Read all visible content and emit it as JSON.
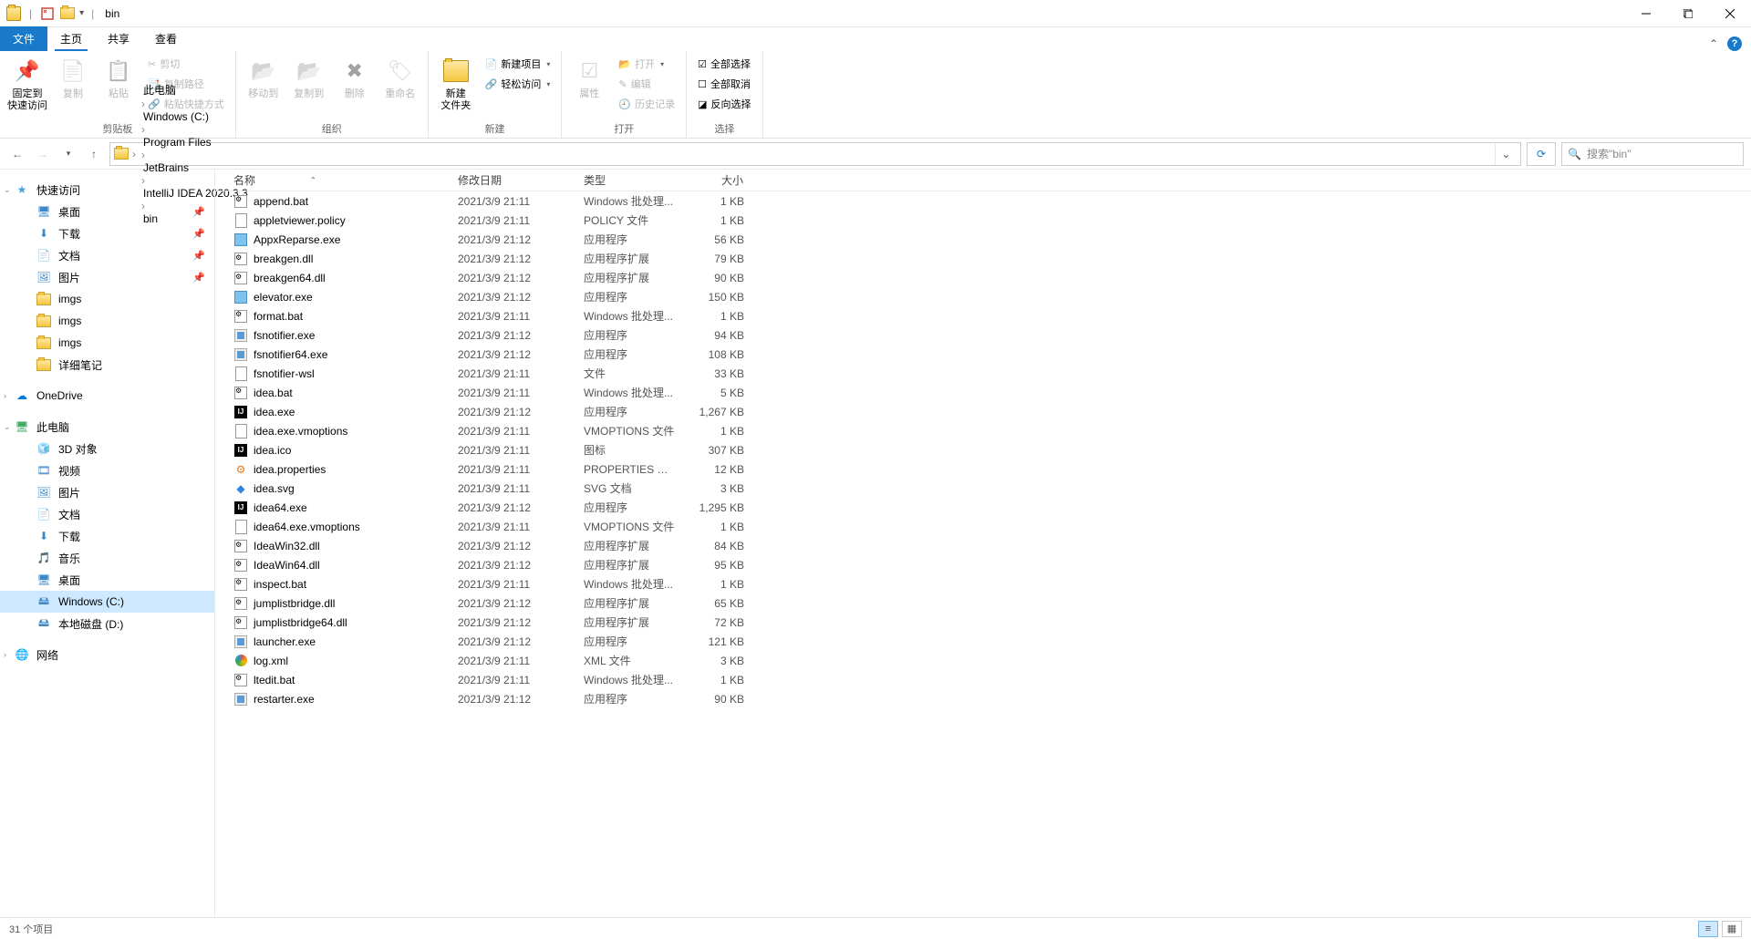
{
  "title": "bin",
  "tabs": {
    "file": "文件",
    "home": "主页",
    "share": "共享",
    "view": "查看"
  },
  "ribbon": {
    "groups": {
      "clipboard": {
        "label": "剪贴板",
        "pin": "固定到\n快速访问",
        "copy": "复制",
        "paste": "粘贴",
        "cut": "剪切",
        "copypath": "复制路径",
        "pasteshortcut": "粘贴快捷方式"
      },
      "organize": {
        "label": "组织",
        "moveto": "移动到",
        "copyto": "复制到",
        "delete": "删除",
        "rename": "重命名"
      },
      "new": {
        "label": "新建",
        "newfolder": "新建\n文件夹",
        "newitem": "新建项目",
        "easyaccess": "轻松访问"
      },
      "open": {
        "label": "打开",
        "properties": "属性",
        "open": "打开",
        "edit": "编辑",
        "history": "历史记录"
      },
      "select": {
        "label": "选择",
        "selectall": "全部选择",
        "selectnone": "全部取消",
        "invert": "反向选择"
      }
    }
  },
  "breadcrumbs": [
    "此电脑",
    "Windows (C:)",
    "Program Files",
    "JetBrains",
    "IntelliJ IDEA 2020.3.3",
    "bin"
  ],
  "search": {
    "placeholder": "搜索\"bin\""
  },
  "sidebar": {
    "quickaccess": "快速访问",
    "qa_items": [
      {
        "label": "桌面",
        "icon": "desktop",
        "pinned": true
      },
      {
        "label": "下载",
        "icon": "downloads",
        "pinned": true
      },
      {
        "label": "文档",
        "icon": "documents",
        "pinned": true
      },
      {
        "label": "图片",
        "icon": "pictures",
        "pinned": true
      },
      {
        "label": "imgs",
        "icon": "folder",
        "pinned": false
      },
      {
        "label": "imgs",
        "icon": "folder",
        "pinned": false
      },
      {
        "label": "imgs",
        "icon": "folder",
        "pinned": false
      },
      {
        "label": "详细笔记",
        "icon": "folder",
        "pinned": false
      }
    ],
    "onedrive": "OneDrive",
    "thispc": "此电脑",
    "pc_items": [
      {
        "label": "3D 对象",
        "icon": "3d"
      },
      {
        "label": "视频",
        "icon": "video"
      },
      {
        "label": "图片",
        "icon": "pictures"
      },
      {
        "label": "文档",
        "icon": "documents"
      },
      {
        "label": "下载",
        "icon": "downloads"
      },
      {
        "label": "音乐",
        "icon": "music"
      },
      {
        "label": "桌面",
        "icon": "desktop"
      },
      {
        "label": "Windows (C:)",
        "icon": "drive",
        "selected": true
      },
      {
        "label": "本地磁盘 (D:)",
        "icon": "drive"
      }
    ],
    "network": "网络"
  },
  "columns": {
    "name": "名称",
    "date": "修改日期",
    "type": "类型",
    "size": "大小"
  },
  "files": [
    {
      "name": "append.bat",
      "date": "2021/3/9 21:11",
      "type": "Windows 批处理...",
      "size": "1 KB",
      "icon": "bat"
    },
    {
      "name": "appletviewer.policy",
      "date": "2021/3/9 21:11",
      "type": "POLICY 文件",
      "size": "1 KB",
      "icon": "file"
    },
    {
      "name": "AppxReparse.exe",
      "date": "2021/3/9 21:12",
      "type": "应用程序",
      "size": "56 KB",
      "icon": "exe"
    },
    {
      "name": "breakgen.dll",
      "date": "2021/3/9 21:12",
      "type": "应用程序扩展",
      "size": "79 KB",
      "icon": "dll"
    },
    {
      "name": "breakgen64.dll",
      "date": "2021/3/9 21:12",
      "type": "应用程序扩展",
      "size": "90 KB",
      "icon": "dll"
    },
    {
      "name": "elevator.exe",
      "date": "2021/3/9 21:12",
      "type": "应用程序",
      "size": "150 KB",
      "icon": "exe"
    },
    {
      "name": "format.bat",
      "date": "2021/3/9 21:11",
      "type": "Windows 批处理...",
      "size": "1 KB",
      "icon": "bat"
    },
    {
      "name": "fsnotifier.exe",
      "date": "2021/3/9 21:12",
      "type": "应用程序",
      "size": "94 KB",
      "icon": "exe2"
    },
    {
      "name": "fsnotifier64.exe",
      "date": "2021/3/9 21:12",
      "type": "应用程序",
      "size": "108 KB",
      "icon": "exe2"
    },
    {
      "name": "fsnotifier-wsl",
      "date": "2021/3/9 21:11",
      "type": "文件",
      "size": "33 KB",
      "icon": "file"
    },
    {
      "name": "idea.bat",
      "date": "2021/3/9 21:11",
      "type": "Windows 批处理...",
      "size": "5 KB",
      "icon": "bat"
    },
    {
      "name": "idea.exe",
      "date": "2021/3/9 21:12",
      "type": "应用程序",
      "size": "1,267 KB",
      "icon": "idea"
    },
    {
      "name": "idea.exe.vmoptions",
      "date": "2021/3/9 21:11",
      "type": "VMOPTIONS 文件",
      "size": "1 KB",
      "icon": "file"
    },
    {
      "name": "idea.ico",
      "date": "2021/3/9 21:11",
      "type": "图标",
      "size": "307 KB",
      "icon": "idea"
    },
    {
      "name": "idea.properties",
      "date": "2021/3/9 21:11",
      "type": "PROPERTIES 文件",
      "size": "12 KB",
      "icon": "prop"
    },
    {
      "name": "idea.svg",
      "date": "2021/3/9 21:11",
      "type": "SVG 文档",
      "size": "3 KB",
      "icon": "svg"
    },
    {
      "name": "idea64.exe",
      "date": "2021/3/9 21:12",
      "type": "应用程序",
      "size": "1,295 KB",
      "icon": "idea"
    },
    {
      "name": "idea64.exe.vmoptions",
      "date": "2021/3/9 21:11",
      "type": "VMOPTIONS 文件",
      "size": "1 KB",
      "icon": "file"
    },
    {
      "name": "IdeaWin32.dll",
      "date": "2021/3/9 21:12",
      "type": "应用程序扩展",
      "size": "84 KB",
      "icon": "dll"
    },
    {
      "name": "IdeaWin64.dll",
      "date": "2021/3/9 21:12",
      "type": "应用程序扩展",
      "size": "95 KB",
      "icon": "dll"
    },
    {
      "name": "inspect.bat",
      "date": "2021/3/9 21:11",
      "type": "Windows 批处理...",
      "size": "1 KB",
      "icon": "bat"
    },
    {
      "name": "jumplistbridge.dll",
      "date": "2021/3/9 21:12",
      "type": "应用程序扩展",
      "size": "65 KB",
      "icon": "dll"
    },
    {
      "name": "jumplistbridge64.dll",
      "date": "2021/3/9 21:12",
      "type": "应用程序扩展",
      "size": "72 KB",
      "icon": "dll"
    },
    {
      "name": "launcher.exe",
      "date": "2021/3/9 21:12",
      "type": "应用程序",
      "size": "121 KB",
      "icon": "exe2"
    },
    {
      "name": "log.xml",
      "date": "2021/3/9 21:11",
      "type": "XML 文件",
      "size": "3 KB",
      "icon": "xml"
    },
    {
      "name": "ltedit.bat",
      "date": "2021/3/9 21:11",
      "type": "Windows 批处理...",
      "size": "1 KB",
      "icon": "bat"
    },
    {
      "name": "restarter.exe",
      "date": "2021/3/9 21:12",
      "type": "应用程序",
      "size": "90 KB",
      "icon": "exe2"
    }
  ],
  "status": {
    "count": "31 个项目"
  }
}
